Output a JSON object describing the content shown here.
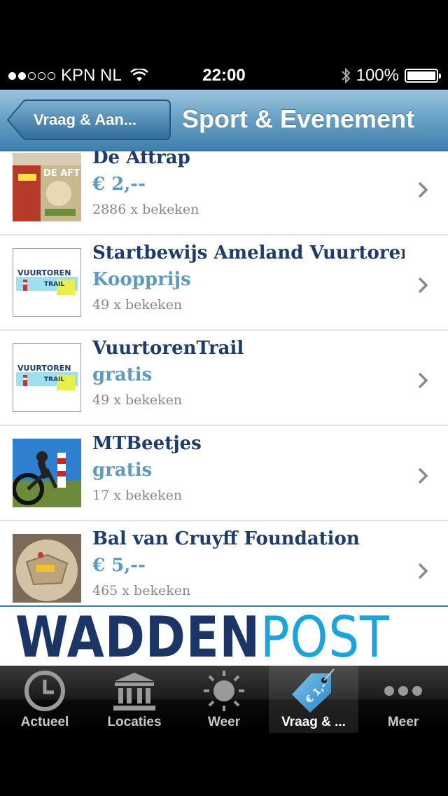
{
  "status": {
    "carrier": "KPN NL",
    "time": "22:00",
    "battery": "100%",
    "signal_bars_filled": 2,
    "signal_bars_total": 5
  },
  "nav": {
    "back_label": "Vraag & Aan...",
    "title": "Sport & Evenement"
  },
  "items": [
    {
      "title": "De Aftrap",
      "price": "€ 2,--",
      "views": "2886 x bekeken"
    },
    {
      "title": "Startbewijs Ameland Vuurtoren",
      "price": "Koopprijs",
      "views": "49 x bekeken"
    },
    {
      "title": "VuurtorenTrail",
      "price": "gratis",
      "views": "49 x bekeken"
    },
    {
      "title": "MTBeetjes",
      "price": "gratis",
      "views": "17 x bekeken"
    },
    {
      "title": "Bal van Cruyff Foundation",
      "price": "€ 5,--",
      "views": "465 x bekeken"
    }
  ],
  "banner": {
    "part1": "WADDEN",
    "part2": "POST"
  },
  "tabs": [
    {
      "label": "Actueel",
      "icon": "clock-icon"
    },
    {
      "label": "Locaties",
      "icon": "building-icon"
    },
    {
      "label": "Weer",
      "icon": "sun-icon"
    },
    {
      "label": "Vraag & ...",
      "icon": "price-tag-icon",
      "active": true
    },
    {
      "label": "Meer",
      "icon": "more-icon"
    }
  ],
  "colors": {
    "nav": "#5f9ac1",
    "title_text": "#1d3b6e",
    "price_text": "#5a9cc1",
    "views_text": "#888888"
  }
}
